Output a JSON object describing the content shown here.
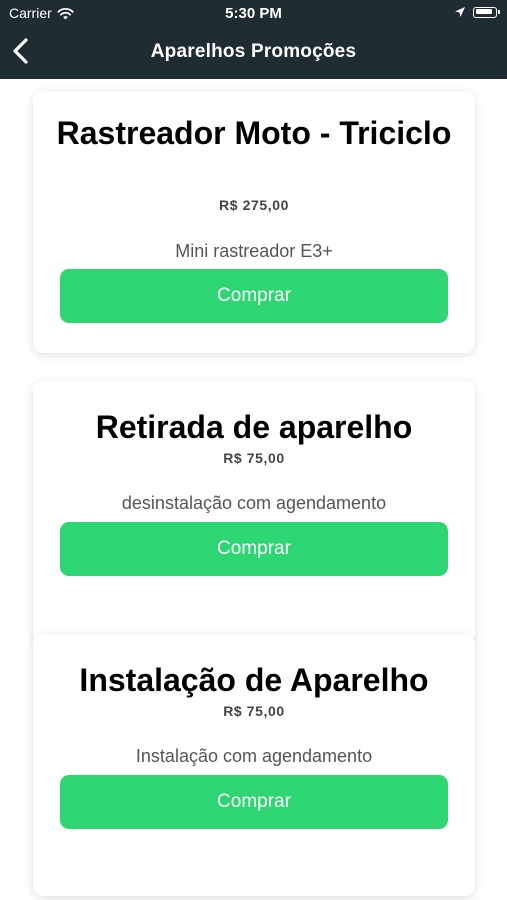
{
  "status_bar": {
    "carrier": "Carrier",
    "time": "5:30 PM"
  },
  "header": {
    "title": "Aparelhos Promoções",
    "back_icon": "chevron-left-icon"
  },
  "colors": {
    "header_bg": "#1f2d33",
    "button_bg": "#2ed573",
    "button_text": "#ffffff"
  },
  "products": [
    {
      "title": "Rastreador Moto - Triciclo",
      "price": "R$ 275,00",
      "description": "Mini rastreador E3+",
      "button_label": "Comprar"
    },
    {
      "title": "Retirada de aparelho",
      "price": "R$ 75,00",
      "description": "desinstalação com agendamento",
      "button_label": "Comprar"
    },
    {
      "title": "Instalação de Aparelho",
      "price": "R$ 75,00",
      "description": "Instalação com agendamento",
      "button_label": "Comprar"
    }
  ]
}
